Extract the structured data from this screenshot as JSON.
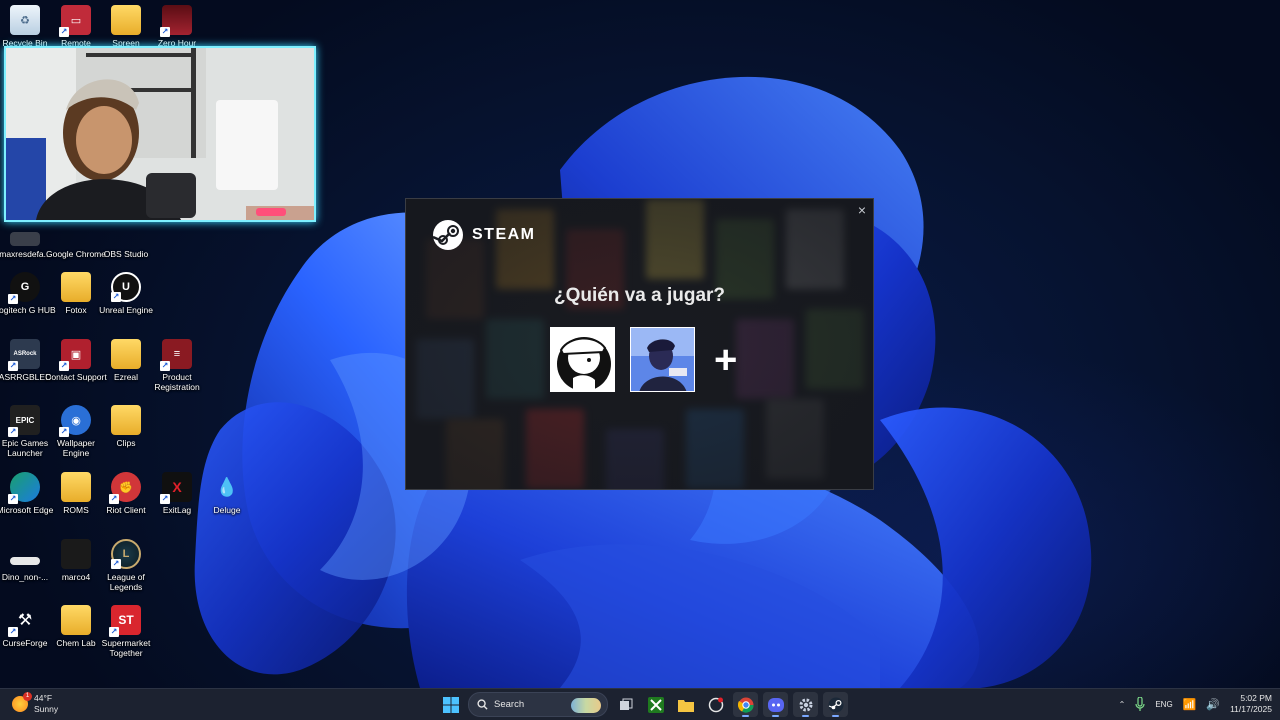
{
  "desktop": {
    "icons": [
      {
        "label": "Recycle Bin",
        "icon": "recycle-bin-icon",
        "color": "#d8e6f2"
      },
      {
        "label": "Remote",
        "icon": "remote-icon",
        "color": "#c02b3a"
      },
      {
        "label": "Spreen",
        "icon": "folder-icon",
        "color": "#f5c542"
      },
      {
        "label": "Zero Hour",
        "icon": "zero-hour-icon",
        "color": "#8a1a22"
      },
      {
        "label": "maxresdefa...",
        "icon": "image-file-icon",
        "color": "#556"
      },
      {
        "label": "Google Chrome",
        "icon": "chrome-icon",
        "color": "#34a853"
      },
      {
        "label": "OBS Studio",
        "icon": "obs-icon",
        "color": "#302e31"
      },
      {
        "label": "Logitech G HUB",
        "icon": "logitech-icon",
        "color": "#111"
      },
      {
        "label": "Fotox",
        "icon": "folder-icon",
        "color": "#f5c542"
      },
      {
        "label": "Unreal Engine",
        "icon": "unreal-icon",
        "color": "#111"
      },
      {
        "label": "ASRRGBLED",
        "icon": "asrock-icon",
        "color": "#2d3a4f"
      },
      {
        "label": "Contact Support",
        "icon": "contact-support-icon",
        "color": "#b0202e"
      },
      {
        "label": "Ezreal",
        "icon": "folder-icon",
        "color": "#f5c542"
      },
      {
        "label": "Product Registration",
        "icon": "product-registration-icon",
        "color": "#8a1a22"
      },
      {
        "label": "Epic Games Launcher",
        "icon": "epic-games-icon",
        "color": "#202020"
      },
      {
        "label": "Wallpaper Engine",
        "icon": "wallpaper-engine-icon",
        "color": "#2a6fd6"
      },
      {
        "label": "Clips",
        "icon": "folder-icon",
        "color": "#f5c542"
      },
      {
        "label": "Microsoft Edge",
        "icon": "edge-icon",
        "color": "#1aa06d"
      },
      {
        "label": "ROMS",
        "icon": "folder-icon",
        "color": "#f5c542"
      },
      {
        "label": "Riot Client",
        "icon": "riot-icon",
        "color": "#d13639"
      },
      {
        "label": "ExitLag",
        "icon": "exitlag-icon",
        "color": "#c0202a"
      },
      {
        "label": "Deluge",
        "icon": "deluge-icon",
        "color": "#3b7be0"
      },
      {
        "label": "Dino_non-...",
        "icon": "file-icon",
        "color": "#e8e8e8"
      },
      {
        "label": "marco4",
        "icon": "file-icon",
        "color": "#1a1a1a"
      },
      {
        "label": "League of Legends",
        "icon": "league-icon",
        "color": "#c8aa6e"
      },
      {
        "label": "CurseForge",
        "icon": "curseforge-icon",
        "color": "#2a2a2a"
      },
      {
        "label": "Chem Lab",
        "icon": "folder-icon",
        "color": "#f5c542"
      },
      {
        "label": "Supermarket Together",
        "icon": "supermarket-icon",
        "color": "#d9262e"
      }
    ]
  },
  "steam": {
    "brand": "STEAM",
    "question": "¿Quién va a jugar?",
    "close_glyph": "×",
    "add_glyph": "+"
  },
  "taskbar": {
    "weather": {
      "temp": "44°F",
      "condition": "Sunny",
      "badge": "1"
    },
    "search_label": "Search",
    "language": "ENG",
    "time": "5:02 PM",
    "date": "11/17/2025"
  }
}
